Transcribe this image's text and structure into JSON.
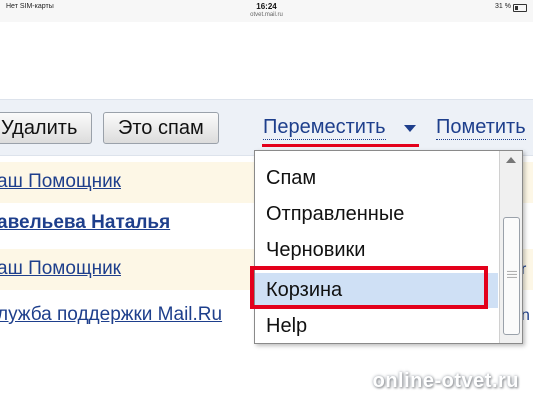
{
  "status_bar": {
    "carrier": "Нет SIM-карты",
    "time": "16:24",
    "url": "otvet.mail.ru",
    "battery": "31 %",
    "battery_level": 0.31
  },
  "toolbar": {
    "delete_label": "Удалить",
    "spam_label": "Это спам",
    "move_label": "Переместить",
    "mark_label": "Пометить"
  },
  "mail_rows": [
    {
      "sender": "аш Помощник",
      "bold": false
    },
    {
      "sender": "авельева Наталья",
      "bold": true
    },
    {
      "sender": "аш Помощник",
      "bold": false
    },
    {
      "sender": "лужба поддержки Mail.Ru",
      "bold": false
    }
  ],
  "move_menu": {
    "items": [
      "Спам",
      "Отправленные",
      "Черновики",
      "Корзина",
      "Help"
    ],
    "selected_index": 3,
    "highlight_color": "#e3001b"
  },
  "watermark": "online-otvet.ru"
}
